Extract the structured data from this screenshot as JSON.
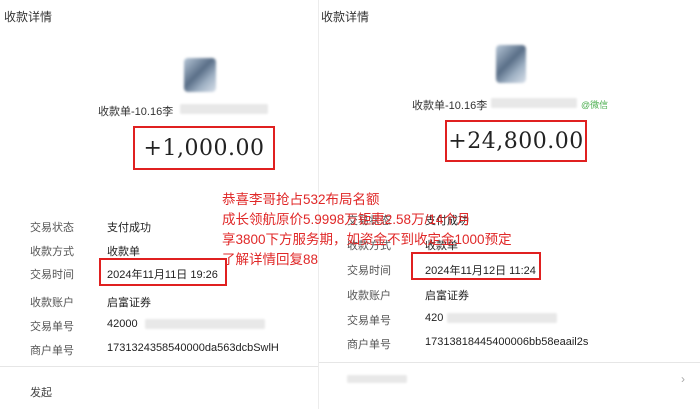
{
  "left": {
    "title": "收款详情",
    "receipt_no": "收款单-10.16李",
    "amount": "+1,000.00",
    "details": [
      {
        "label": "交易状态",
        "value": "支付成功"
      },
      {
        "label": "收款方式",
        "value": "收款单"
      },
      {
        "label": "交易时间",
        "value": "2024年11月11日 19:26"
      },
      {
        "label": "收款账户",
        "value": "启富证券"
      },
      {
        "label": "交易单号",
        "value": "42000"
      },
      {
        "label": "商户单号",
        "value": "1731324358540000da563dcbSwlH"
      }
    ],
    "footer": "发起"
  },
  "right": {
    "title": "收款详情",
    "receipt_no": "收款单-10.16李",
    "wechat_tag": "@微信",
    "amount": "+24,800.00",
    "details": [
      {
        "label": "交易状态",
        "value": "支付成功"
      },
      {
        "label": "收款方式",
        "value": "收款单"
      },
      {
        "label": "交易时间",
        "value": "2024年11月12日 11:24"
      },
      {
        "label": "收款账户",
        "value": "启富证券"
      },
      {
        "label": "交易单号",
        "value": "420"
      },
      {
        "label": "商户单号",
        "value": "17313818445400006bb58eaail2s"
      }
    ],
    "chevron": "›"
  },
  "overlay": [
    "恭喜李哥抢占532布局名额",
    "成长领航原价5.9998万钜惠2.58万/14个月",
    "享3800下方服务期，如资金不到收定金1000预定",
    "了解详情回复88"
  ],
  "colors": {
    "highlight": "#e02020",
    "overlay_text": "#e02828"
  }
}
